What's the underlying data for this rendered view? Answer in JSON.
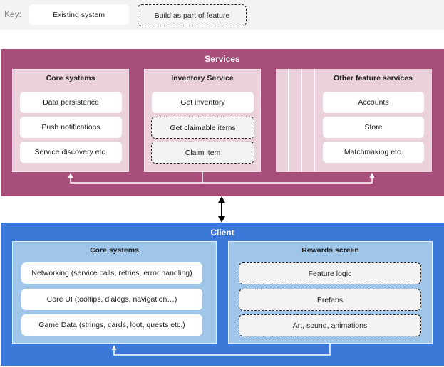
{
  "key": {
    "label": "Key:",
    "existing": "Existing system",
    "new": "Build as part of feature"
  },
  "services": {
    "title": "Services",
    "color": "#a64d79",
    "panels": [
      {
        "title": "Core systems",
        "items": [
          {
            "label": "Data persistence",
            "type": "existing"
          },
          {
            "label": "Push notifications",
            "type": "existing"
          },
          {
            "label": "Service discovery etc.",
            "type": "existing"
          }
        ]
      },
      {
        "title": "Inventory Service",
        "items": [
          {
            "label": "Get inventory",
            "type": "existing"
          },
          {
            "label": "Get claimable items",
            "type": "new"
          },
          {
            "label": "Claim item",
            "type": "new"
          }
        ]
      },
      {
        "title": "Other feature services",
        "items": [
          {
            "label": "Accounts",
            "type": "existing"
          },
          {
            "label": "Store",
            "type": "existing"
          },
          {
            "label": "Matchmaking etc.",
            "type": "existing"
          }
        ]
      }
    ]
  },
  "client": {
    "title": "Client",
    "color": "#3c78d8",
    "panels": [
      {
        "title": "Core systems",
        "items": [
          {
            "label": "Networking (service calls, retries, error handling)",
            "type": "existing"
          },
          {
            "label": "Core UI (tooltips, dialogs, navigation…)",
            "type": "existing"
          },
          {
            "label": "Game Data (strings, cards, loot, quests etc.)",
            "type": "existing"
          }
        ]
      },
      {
        "title": "Rewards screen",
        "items": [
          {
            "label": "Feature logic",
            "type": "new"
          },
          {
            "label": "Prefabs",
            "type": "new"
          },
          {
            "label": "Art, sound, animations",
            "type": "new"
          }
        ]
      }
    ]
  }
}
